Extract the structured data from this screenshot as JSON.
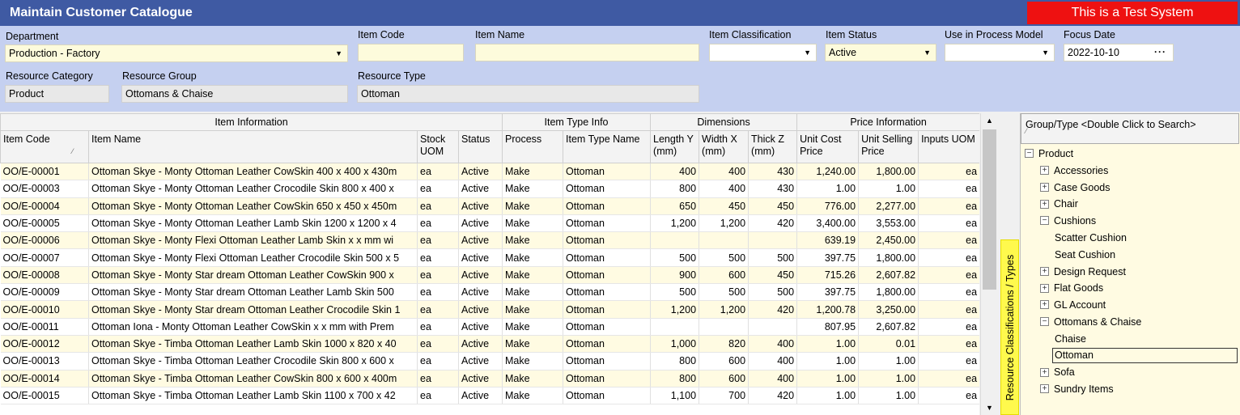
{
  "window": {
    "title": "Maintain Customer Catalogue",
    "test_banner": "This is a Test System"
  },
  "filters": {
    "department": {
      "label": "Department",
      "value": "Production - Factory"
    },
    "item_code": {
      "label": "Item Code",
      "value": ""
    },
    "item_name": {
      "label": "Item Name",
      "value": ""
    },
    "item_classification": {
      "label": "Item Classification",
      "value": ""
    },
    "item_status": {
      "label": "Item Status",
      "value": "Active"
    },
    "use_in_process_model": {
      "label": "Use in Process Model",
      "value": ""
    },
    "focus_date": {
      "label": "Focus Date",
      "value": "2022-10-10"
    },
    "resource_category": {
      "label": "Resource Category",
      "value": "Product"
    },
    "resource_group": {
      "label": "Resource Group",
      "value": "Ottomans & Chaise"
    },
    "resource_type": {
      "label": "Resource Type",
      "value": "Ottoman"
    }
  },
  "grid": {
    "groups": [
      "Item Information",
      "Item Type Info",
      "Dimensions",
      "Price Information"
    ],
    "columns": [
      "Item Code",
      "Item Name",
      "Stock UOM",
      "Status",
      "Process",
      "Item Type Name",
      "Length Y (mm)",
      "Width X (mm)",
      "Thick Z (mm)",
      "Unit Cost Price",
      "Unit Selling Price",
      "Inputs UOM"
    ],
    "rows": [
      [
        "OO/E-00001",
        "Ottoman Skye - Monty Ottoman Leather CowSkin 400 x 400 x 430m",
        "ea",
        "Active",
        "Make",
        "Ottoman",
        "400",
        "400",
        "430",
        "1,240.00",
        "1,800.00",
        "ea"
      ],
      [
        "OO/E-00003",
        "Ottoman Skye - Monty Ottoman Leather Crocodile Skin 800 x 400 x",
        "ea",
        "Active",
        "Make",
        "Ottoman",
        "800",
        "400",
        "430",
        "1.00",
        "1.00",
        "ea"
      ],
      [
        "OO/E-00004",
        "Ottoman Skye - Monty Ottoman Leather CowSkin 650 x 450 x 450m",
        "ea",
        "Active",
        "Make",
        "Ottoman",
        "650",
        "450",
        "450",
        "776.00",
        "2,277.00",
        "ea"
      ],
      [
        "OO/E-00005",
        "Ottoman Skye - Monty Ottoman Leather Lamb Skin 1200 x 1200 x 4",
        "ea",
        "Active",
        "Make",
        "Ottoman",
        "1,200",
        "1,200",
        "420",
        "3,400.00",
        "3,553.00",
        "ea"
      ],
      [
        "OO/E-00006",
        "Ottoman Skye - Monty Flexi Ottoman Leather Lamb Skin  x  x mm wi",
        "ea",
        "Active",
        "Make",
        "Ottoman",
        "",
        "",
        "",
        "639.19",
        "2,450.00",
        "ea"
      ],
      [
        "OO/E-00007",
        "Ottoman Skye - Monty Flexi Ottoman Leather Crocodile Skin 500 x 5",
        "ea",
        "Active",
        "Make",
        "Ottoman",
        "500",
        "500",
        "500",
        "397.75",
        "1,800.00",
        "ea"
      ],
      [
        "OO/E-00008",
        "Ottoman Skye - Monty Star dream Ottoman Leather CowSkin 900 x",
        "ea",
        "Active",
        "Make",
        "Ottoman",
        "900",
        "600",
        "450",
        "715.26",
        "2,607.82",
        "ea"
      ],
      [
        "OO/E-00009",
        "Ottoman Skye - Monty Star dream Ottoman Leather Lamb Skin 500",
        "ea",
        "Active",
        "Make",
        "Ottoman",
        "500",
        "500",
        "500",
        "397.75",
        "1,800.00",
        "ea"
      ],
      [
        "OO/E-00010",
        "Ottoman Skye - Monty Star dream Ottoman Leather Crocodile Skin 1",
        "ea",
        "Active",
        "Make",
        "Ottoman",
        "1,200",
        "1,200",
        "420",
        "1,200.78",
        "3,250.00",
        "ea"
      ],
      [
        "OO/E-00011",
        "Ottoman Iona - Monty Ottoman Leather CowSkin  x  x mm with Prem",
        "ea",
        "Active",
        "Make",
        "Ottoman",
        "",
        "",
        "",
        "807.95",
        "2,607.82",
        "ea"
      ],
      [
        "OO/E-00012",
        "Ottoman Skye - Timba Ottoman Leather Lamb Skin 1000 x 820 x 40",
        "ea",
        "Active",
        "Make",
        "Ottoman",
        "1,000",
        "820",
        "400",
        "1.00",
        "0.01",
        "ea"
      ],
      [
        "OO/E-00013",
        "Ottoman Skye - Timba Ottoman Leather Crocodile Skin 800 x 600 x",
        "ea",
        "Active",
        "Make",
        "Ottoman",
        "800",
        "600",
        "400",
        "1.00",
        "1.00",
        "ea"
      ],
      [
        "OO/E-00014",
        "Ottoman Skye - Timba Ottoman Leather CowSkin 800 x 600 x 400m",
        "ea",
        "Active",
        "Make",
        "Ottoman",
        "800",
        "600",
        "400",
        "1.00",
        "1.00",
        "ea"
      ],
      [
        "OO/E-00015",
        "Ottoman Skye - Timba Ottoman Leather Lamb Skin 1100 x 700 x 42",
        "ea",
        "Active",
        "Make",
        "Ottoman",
        "1,100",
        "700",
        "420",
        "1.00",
        "1.00",
        "ea"
      ]
    ]
  },
  "side_tab": {
    "label": "Resource Classifications / Types"
  },
  "tree": {
    "header": "Group/Type    <Double Click to Search>",
    "nodes": [
      {
        "label": "Product",
        "level": 0,
        "state": "expanded"
      },
      {
        "label": "Accessories",
        "level": 1,
        "state": "collapsed"
      },
      {
        "label": "Case Goods",
        "level": 1,
        "state": "collapsed"
      },
      {
        "label": "Chair",
        "level": 1,
        "state": "collapsed"
      },
      {
        "label": "Cushions",
        "level": 1,
        "state": "expanded"
      },
      {
        "label": "Scatter Cushion",
        "level": 2,
        "state": "leaf"
      },
      {
        "label": "Seat Cushion",
        "level": 2,
        "state": "leaf"
      },
      {
        "label": "Design Request",
        "level": 1,
        "state": "collapsed"
      },
      {
        "label": "Flat Goods",
        "level": 1,
        "state": "collapsed"
      },
      {
        "label": "GL Account",
        "level": 1,
        "state": "collapsed"
      },
      {
        "label": "Ottomans & Chaise",
        "level": 1,
        "state": "expanded"
      },
      {
        "label": "Chaise",
        "level": 2,
        "state": "leaf"
      },
      {
        "label": "Ottoman",
        "level": 2,
        "state": "selected"
      },
      {
        "label": "Sofa",
        "level": 1,
        "state": "collapsed"
      },
      {
        "label": "Sundry Items",
        "level": 1,
        "state": "collapsed"
      }
    ]
  },
  "colors": {
    "titlebar": "#3f5aa3",
    "filter_panel": "#c5d0f0",
    "test_banner": "#ee1111",
    "row_highlight": "#fffbe2",
    "side_tab": "#fff94d"
  }
}
